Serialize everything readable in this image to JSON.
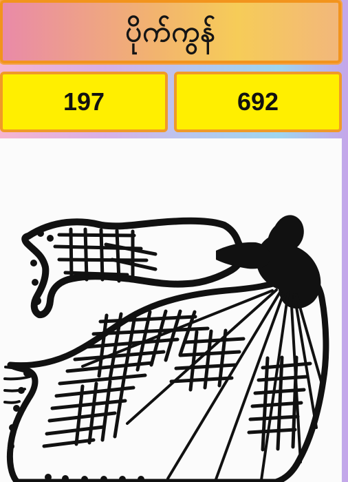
{
  "header": {
    "title": "ပိုက်ကွန်"
  },
  "numbers": {
    "left": "197",
    "right": "692"
  },
  "illustration": {
    "icon": "fishing-net-illustration-icon",
    "colors": {
      "ink": "#111111",
      "paper": "#fbfbfb"
    }
  }
}
